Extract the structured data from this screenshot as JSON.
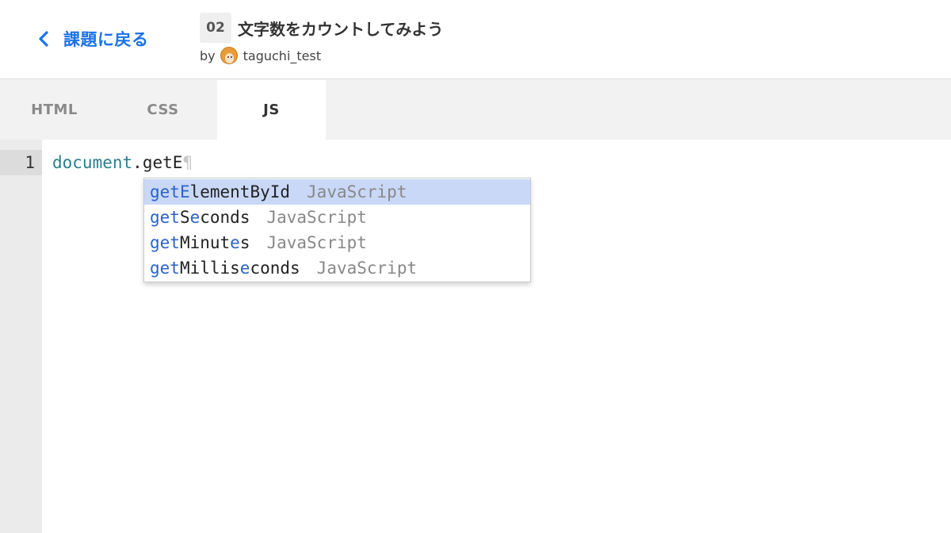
{
  "header": {
    "back_label": "課題に戻る",
    "task_number": "02",
    "task_title": "文字数をカウントしてみよう",
    "by_label": "by",
    "author_name": "taguchi_test"
  },
  "tabs": [
    {
      "label": "HTML",
      "active": false
    },
    {
      "label": "CSS",
      "active": false
    },
    {
      "label": "JS",
      "active": true
    }
  ],
  "editor": {
    "line_number": "1",
    "code": {
      "object": "document",
      "dot": ".",
      "typed": "getE",
      "pilcrow": "¶"
    }
  },
  "autocomplete": {
    "items": [
      {
        "segments": [
          {
            "t": "get",
            "m": true
          },
          {
            "t": "E",
            "m": true
          },
          {
            "t": "lementById",
            "m": false
          }
        ],
        "type": "JavaScript",
        "selected": true
      },
      {
        "segments": [
          {
            "t": "get",
            "m": true
          },
          {
            "t": "S",
            "m": false
          },
          {
            "t": "e",
            "m": true
          },
          {
            "t": "conds",
            "m": false
          }
        ],
        "type": "JavaScript",
        "selected": false
      },
      {
        "segments": [
          {
            "t": "get",
            "m": true
          },
          {
            "t": "Minut",
            "m": false
          },
          {
            "t": "e",
            "m": true
          },
          {
            "t": "s",
            "m": false
          }
        ],
        "type": "JavaScript",
        "selected": false
      },
      {
        "segments": [
          {
            "t": "get",
            "m": true
          },
          {
            "t": "Millis",
            "m": false
          },
          {
            "t": "e",
            "m": true
          },
          {
            "t": "conds",
            "m": false
          }
        ],
        "type": "JavaScript",
        "selected": false
      }
    ]
  },
  "colors": {
    "accent": "#1a73e8",
    "match": "#2b63c6",
    "selected_bg": "#c9d8f7",
    "object_token": "#2a7f8f"
  },
  "icons": {
    "back": "chevron-left-icon",
    "avatar": "user-avatar"
  }
}
